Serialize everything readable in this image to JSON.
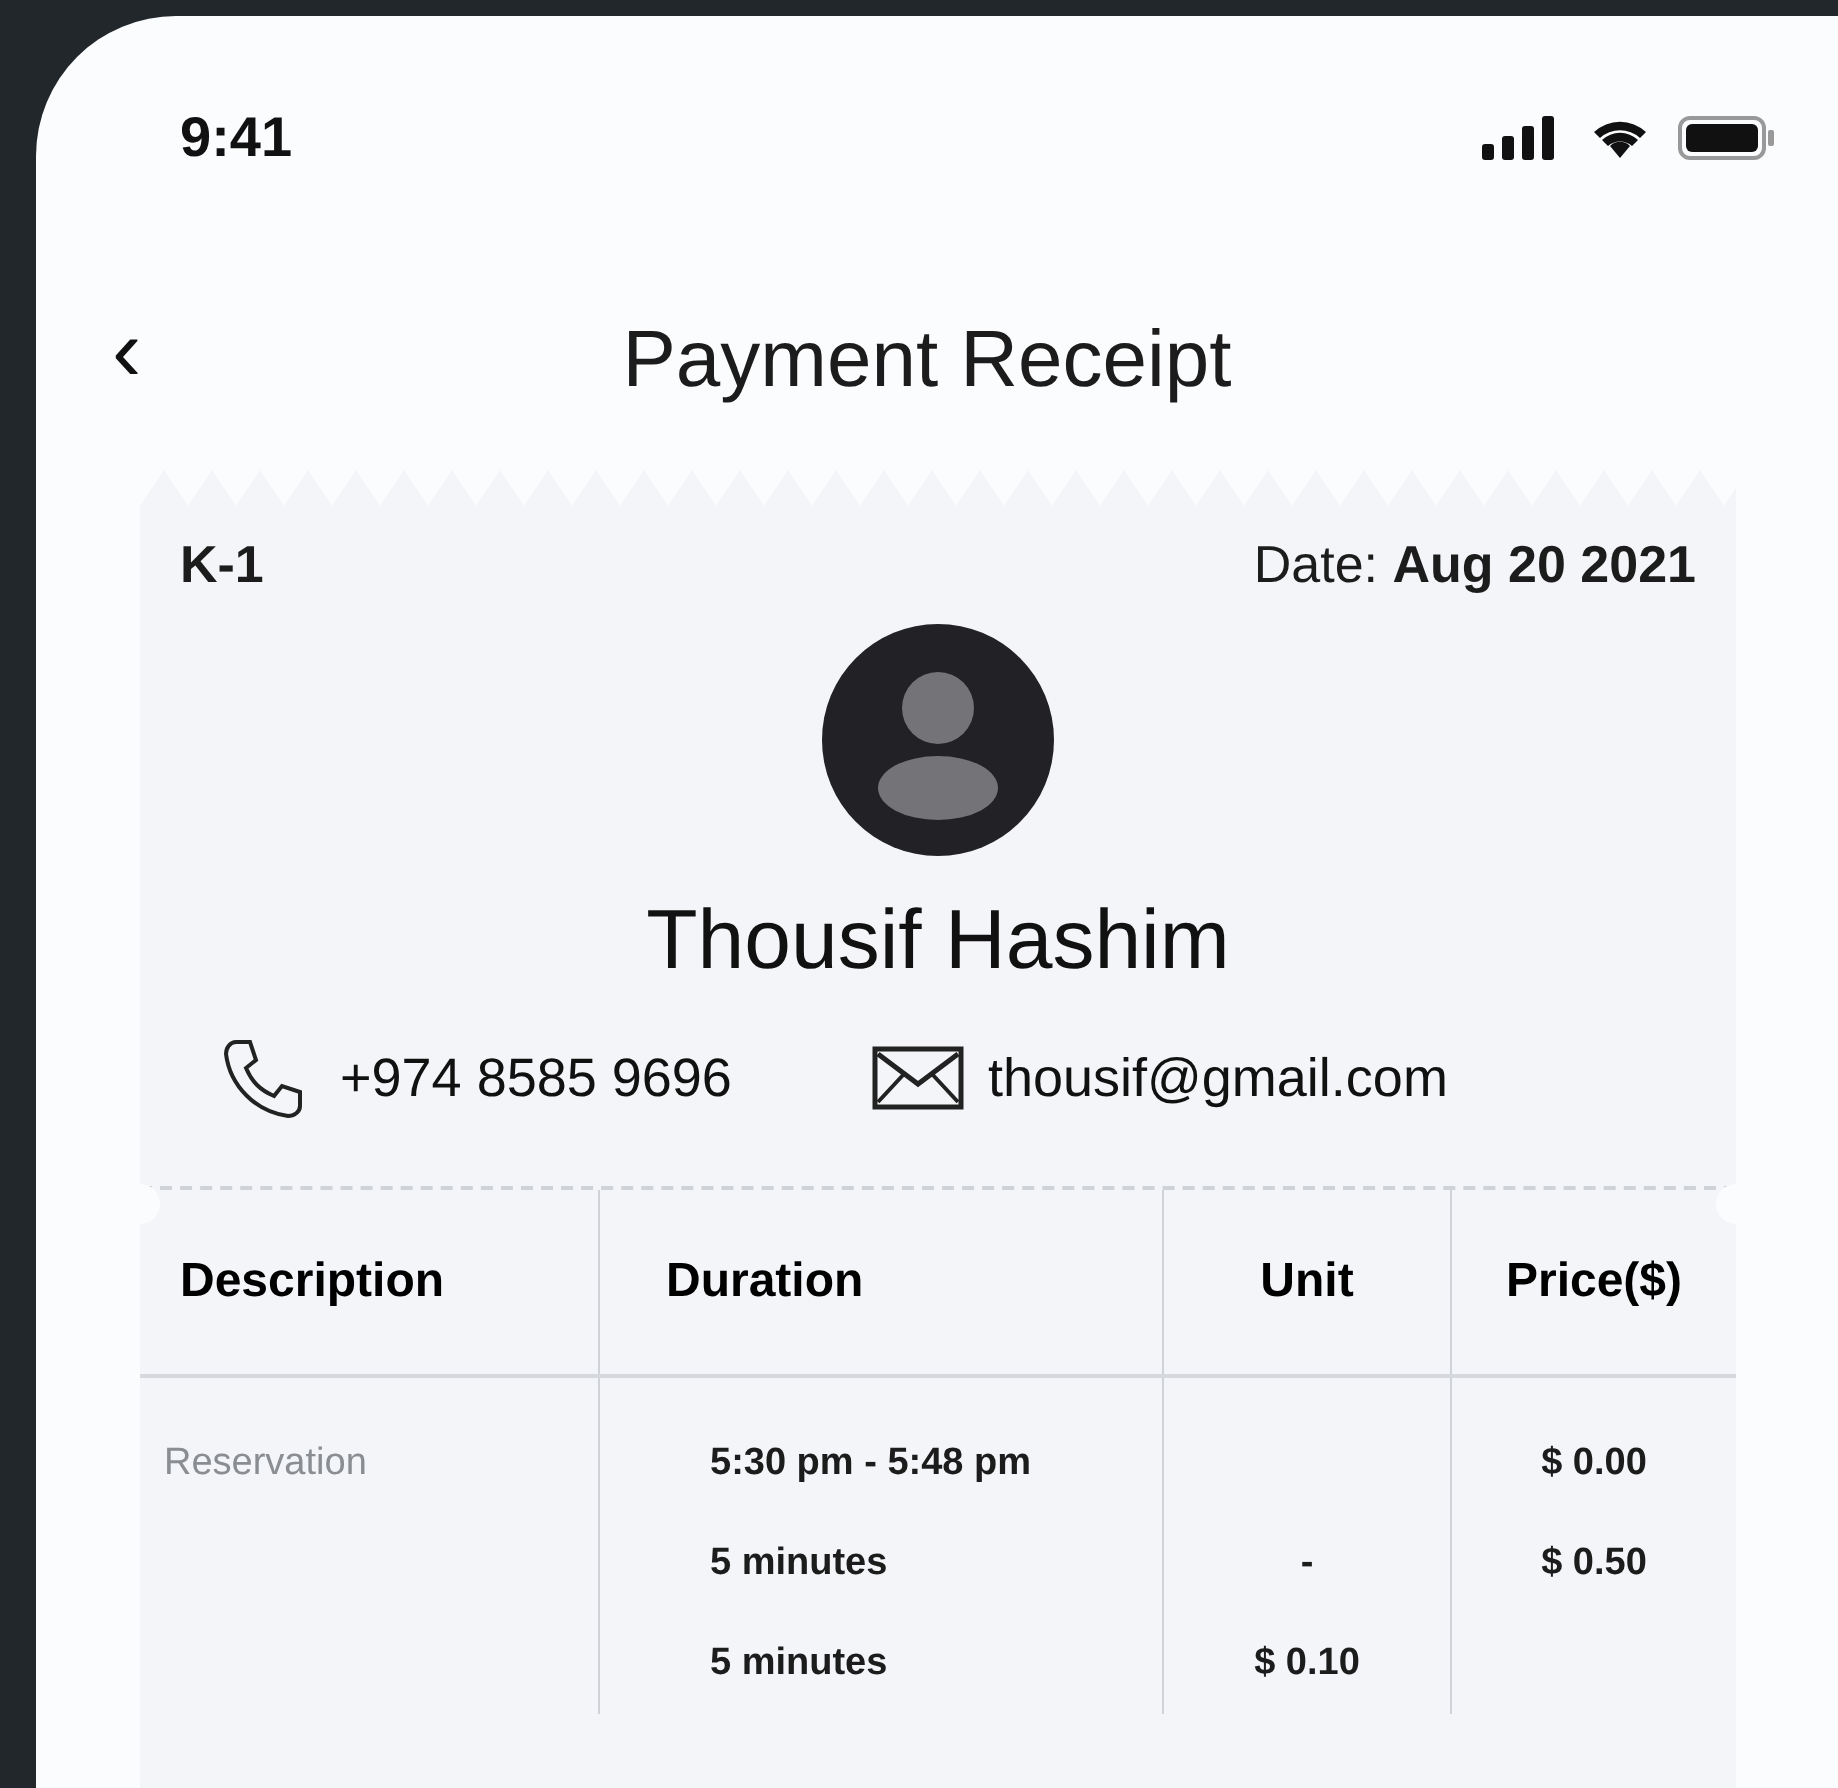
{
  "status_bar": {
    "time": "9:41"
  },
  "header": {
    "back": "‹",
    "title": "Payment Receipt"
  },
  "receipt": {
    "number": "K-1",
    "date_label": "Date:",
    "date": "Aug 20 2021",
    "customer": {
      "name": "Thousif Hashim",
      "phone": "+974 8585 9696",
      "email": "thousif@gmail.com"
    },
    "table": {
      "columns": [
        "Description",
        "Duration",
        "Unit",
        "Price($)"
      ],
      "rows": [
        {
          "description": "Reservation",
          "duration": "5:30 pm -  5:48 pm",
          "price": "$ 0.00"
        },
        {
          "duration": "5 minutes",
          "unit": "-",
          "price": "$ 0.50"
        },
        {
          "duration": "5 minutes",
          "unit": "$ 0.10"
        }
      ]
    }
  }
}
